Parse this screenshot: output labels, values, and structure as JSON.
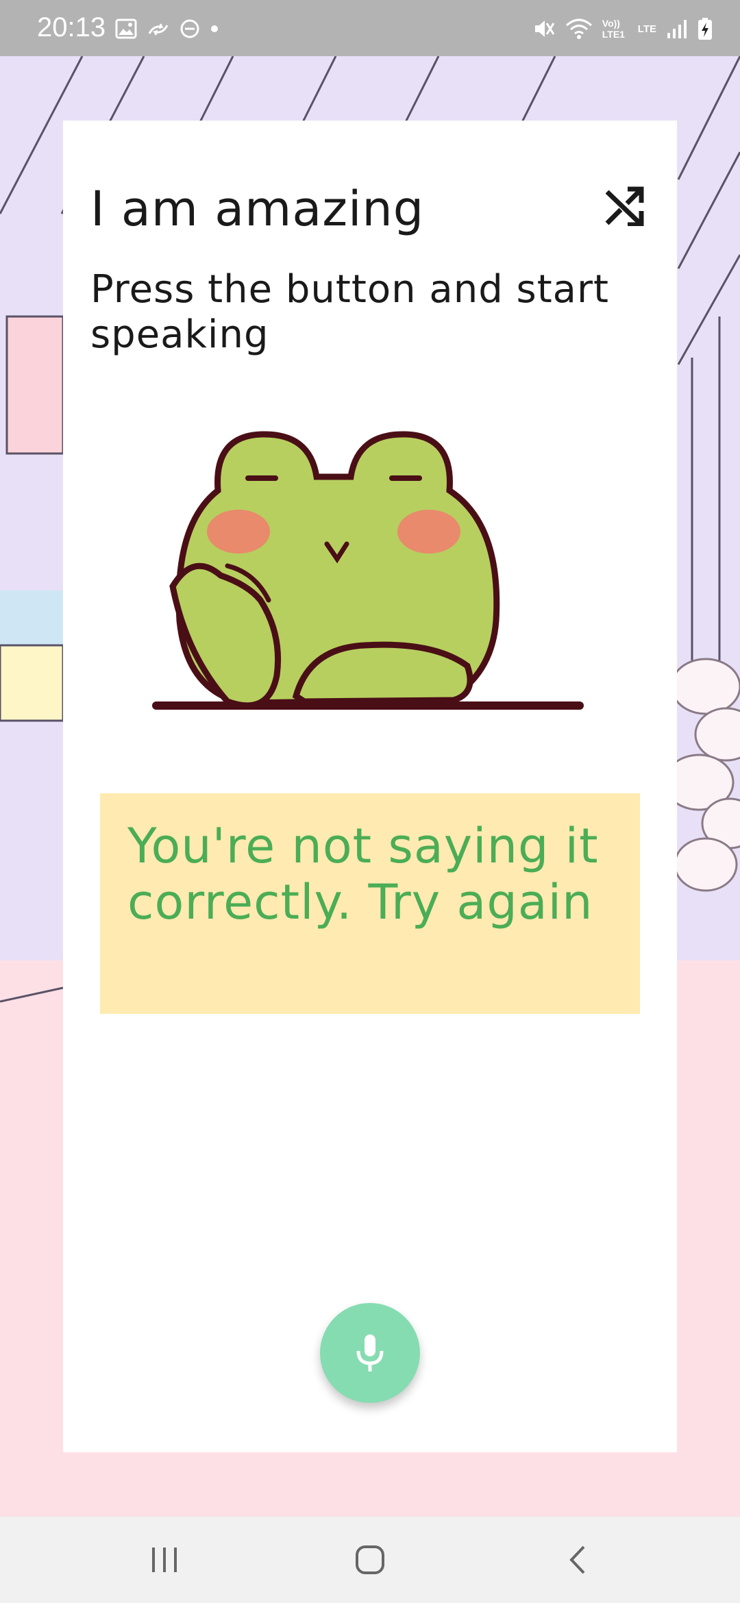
{
  "status_bar": {
    "time": "20:13",
    "left_icons": [
      "image-icon",
      "sync-icon",
      "do-not-disturb-icon",
      "dot-icon"
    ],
    "right_icons": [
      "mute-icon",
      "wifi-icon",
      "volte-icon",
      "lte-icon",
      "signal-icon",
      "battery-charging-icon"
    ],
    "volte_label": "Vo)) LTE1",
    "lte_label": "LTE"
  },
  "card": {
    "title": "I am amazing",
    "instruction": "Press the button and start speaking",
    "shuffle_icon": "shuffle-icon",
    "illustration": "frog-illustration",
    "feedback": "You're not saying it correctly. Try again",
    "mic_icon": "microphone-icon"
  },
  "colors": {
    "feedback_bg": "#ffeab1",
    "feedback_text": "#4bad55",
    "mic_button": "#86dcb1",
    "background_pink": "#fde0e6",
    "background_lavender": "#e7e0f7"
  },
  "nav_bar": {
    "recent_icon": "recent-apps-icon",
    "home_icon": "home-icon",
    "back_icon": "back-icon"
  }
}
